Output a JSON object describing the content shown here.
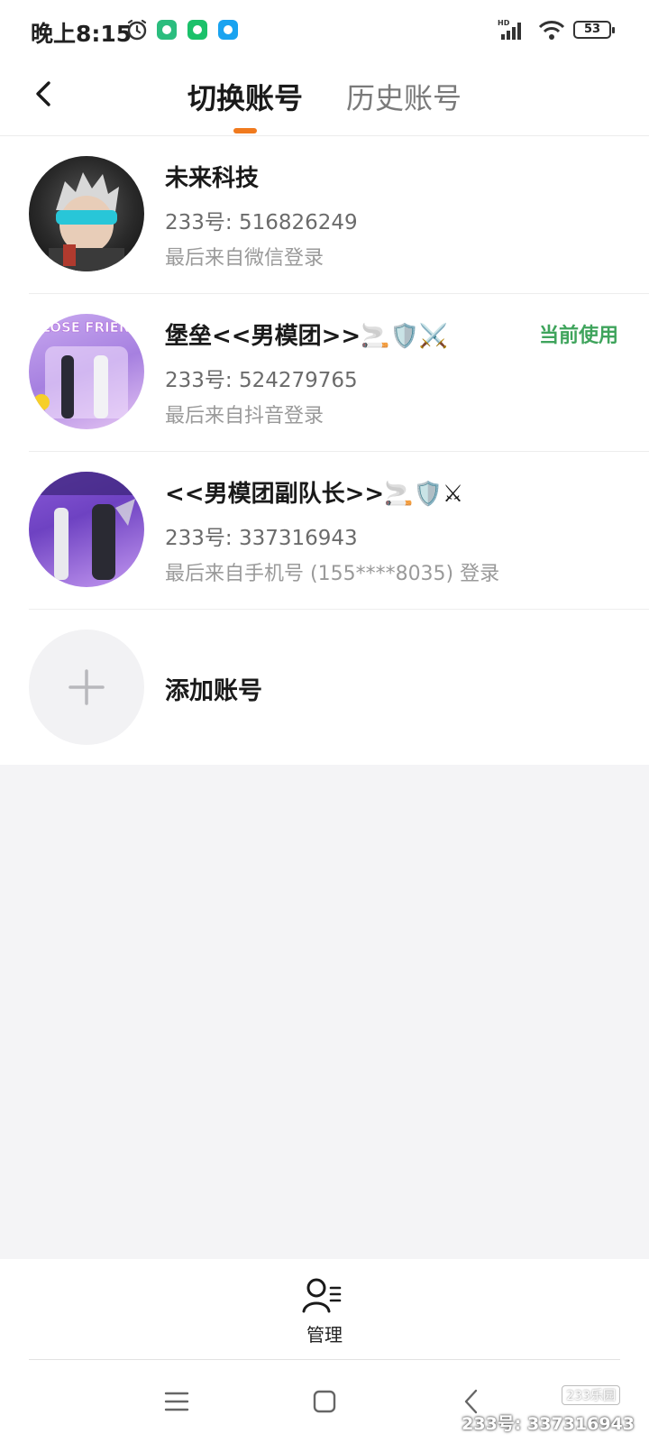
{
  "status_bar": {
    "time": "晚上8:15",
    "battery": "53",
    "network_label": "HD"
  },
  "header": {
    "tabs": [
      {
        "label": "切换账号",
        "active": true
      },
      {
        "label": "历史账号",
        "active": false
      }
    ],
    "accent_color": "#f07a1e"
  },
  "accounts": [
    {
      "name": "未来科技",
      "id": "233号: 516826249",
      "login": "最后来自微信登录",
      "current": false
    },
    {
      "name": "堡垒<<男模团>>🚬🛡️⚔️",
      "id": "233号: 524279765",
      "login": "最后来自抖音登录",
      "current": true,
      "current_label": "当前使用",
      "avatar_text": "CLOSE FRIEND"
    },
    {
      "name": "<<男模团副队长>>🚬🛡️⚔",
      "id": "233号: 337316943",
      "login": "最后来自手机号 (155****8035) 登录",
      "current": false
    }
  ],
  "add_account": {
    "label": "添加账号"
  },
  "bottom": {
    "manage_label": "管理"
  },
  "watermark": {
    "logo": "233乐园",
    "text": "233号: 337316943"
  },
  "colors": {
    "current_tag": "#3fa45c",
    "background": "#f4f4f6"
  }
}
